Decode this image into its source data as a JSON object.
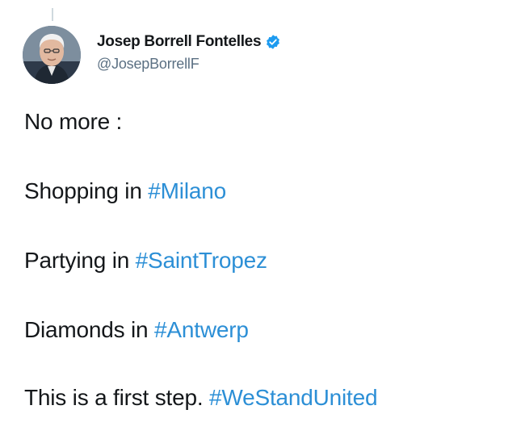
{
  "tweet": {
    "author": {
      "display_name": "Josep Borrell Fontelles",
      "handle": "@JosepBorrellF",
      "verified": true,
      "avatar_icon": "profile-photo"
    },
    "lines": [
      {
        "text": "No more :",
        "hashtag": ""
      },
      {
        "text": "Shopping in ",
        "hashtag": "#Milano"
      },
      {
        "text": "Partying in ",
        "hashtag": "#SaintTropez"
      },
      {
        "text": "Diamonds in ",
        "hashtag": "#Antwerp"
      },
      {
        "text": "This is a first step. ",
        "hashtag": "#WeStandUnited"
      }
    ]
  },
  "colors": {
    "hashtag": "#2c8fd6",
    "verified_badge": "#1d9bf0",
    "handle": "#5b7083",
    "text": "#14171a"
  }
}
